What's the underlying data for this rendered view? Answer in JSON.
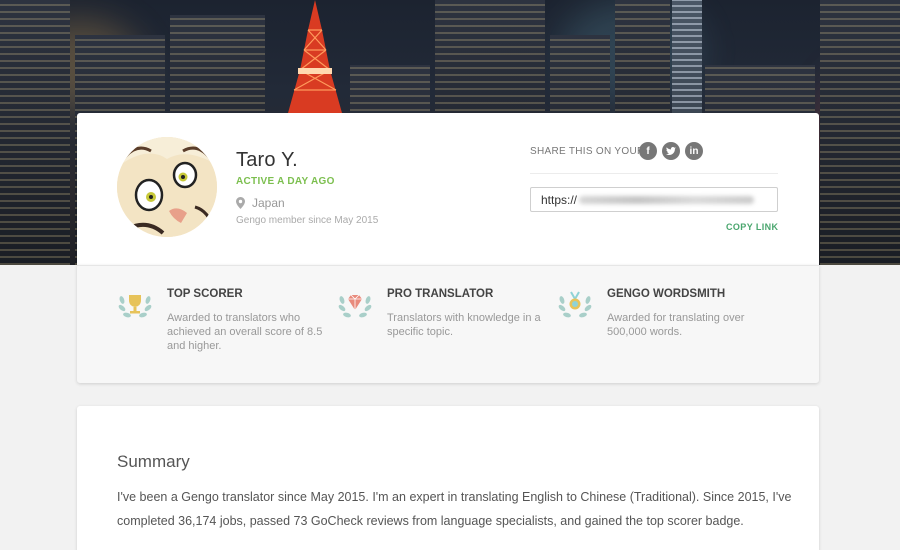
{
  "profile": {
    "name": "Taro Y.",
    "status": "ACTIVE A DAY AGO",
    "location": "Japan",
    "member_since": "Gengo member since May 2015"
  },
  "share": {
    "label": "SHARE THIS ON YOUR",
    "networks": [
      {
        "name": "facebook",
        "glyph": "f"
      },
      {
        "name": "twitter",
        "glyph": "t"
      },
      {
        "name": "linkedin",
        "glyph": "in"
      }
    ],
    "link_value": "https://",
    "copy_label": "COPY LINK"
  },
  "badges": [
    {
      "title": "TOP SCORER",
      "description": "Awarded to translators who achieved an overall score of 8.5 and higher.",
      "icon": "trophy-icon",
      "color": "#e7c35a"
    },
    {
      "title": "PRO TRANSLATOR",
      "description": "Translators with knowledge in a specific topic.",
      "icon": "diamond-icon",
      "color": "#e88a7c"
    },
    {
      "title": "GENGO WORDSMITH",
      "description": "Awarded for translating over 500,000 words.",
      "icon": "medal-icon",
      "color": "#8fd3d6"
    }
  ],
  "summary": {
    "title": "Summary",
    "text": "I've been a Gengo translator since May 2015. I'm an expert in translating English to Chinese (Traditional). Since 2015, I've completed 36,174 jobs, passed 73 GoCheck reviews from language specialists, and gained the top scorer badge."
  },
  "colors": {
    "accent_green": "#7cbf4f",
    "link_green": "#4aa66e",
    "wreath": "#a9cfc9"
  }
}
